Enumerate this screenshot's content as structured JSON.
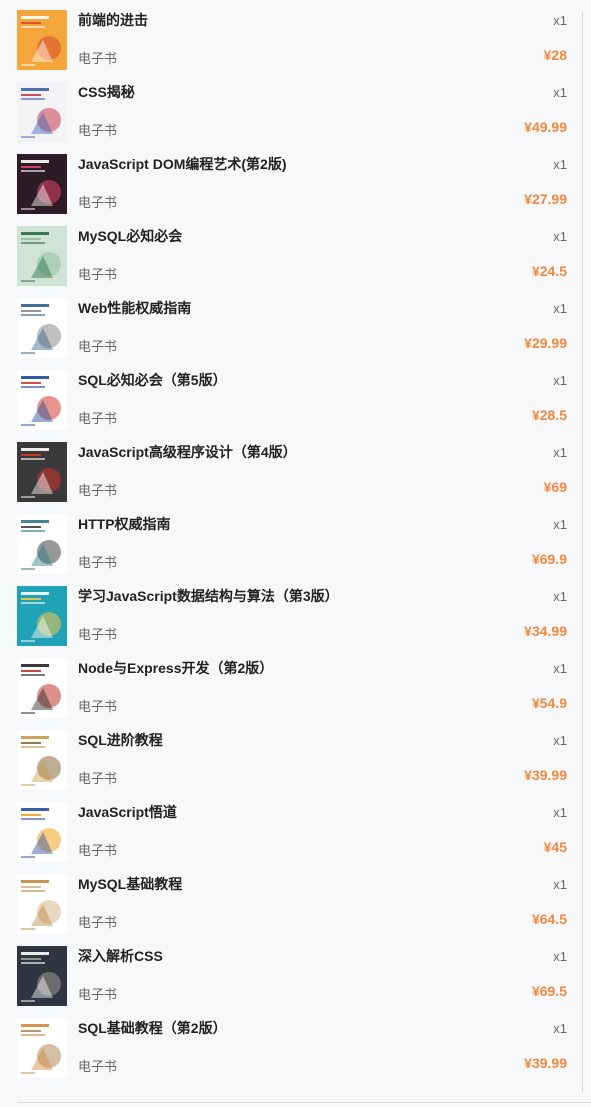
{
  "items": [
    {
      "title": "前端的进击",
      "qty": "x1",
      "type": "电子书",
      "price": "¥28",
      "cover": {
        "icon": "book-cover-front-end",
        "bg": "#f4a63a",
        "fg": "#ffffff",
        "accent": "#d84a2d"
      }
    },
    {
      "title": "CSS揭秘",
      "qty": "x1",
      "type": "电子书",
      "price": "¥49.99",
      "cover": {
        "icon": "book-cover-css-secrets",
        "bg": "#f3f3f6",
        "fg": "#3b63b0",
        "accent": "#cc3a4e"
      }
    },
    {
      "title": "JavaScript DOM编程艺术(第2版)",
      "qty": "x1",
      "type": "电子书",
      "price": "¥27.99",
      "cover": {
        "icon": "book-cover-dom-scripting",
        "bg": "#2b1c25",
        "fg": "#ffffff",
        "accent": "#e6416a"
      }
    },
    {
      "title": "MySQL必知必会",
      "qty": "x1",
      "type": "电子书",
      "price": "¥24.5",
      "cover": {
        "icon": "book-cover-mysql-crash-course",
        "bg": "#cfe4d6",
        "fg": "#2b6a47",
        "accent": "#8fbda1"
      }
    },
    {
      "title": "Web性能权威指南",
      "qty": "x1",
      "type": "电子书",
      "price": "¥29.99",
      "cover": {
        "icon": "book-cover-web-performance",
        "bg": "#ffffff",
        "fg": "#2f5f8a",
        "accent": "#8a8a8a"
      }
    },
    {
      "title": "SQL必知必会（第5版）",
      "qty": "x1",
      "type": "电子书",
      "price": "¥28.5",
      "cover": {
        "icon": "book-cover-sql-crash-course",
        "bg": "#ffffff",
        "fg": "#1d4b9c",
        "accent": "#d63b32"
      }
    },
    {
      "title": "JavaScript高级程序设计（第4版）",
      "qty": "x1",
      "type": "电子书",
      "price": "¥69",
      "cover": {
        "icon": "book-cover-professional-javascript",
        "bg": "#3a3a3a",
        "fg": "#ffffff",
        "accent": "#d1352c"
      }
    },
    {
      "title": "HTTP权威指南",
      "qty": "x1",
      "type": "电子书",
      "price": "¥69.9",
      "cover": {
        "icon": "book-cover-http-definitive-guide",
        "bg": "#ffffff",
        "fg": "#2a7a8c",
        "accent": "#444444"
      }
    },
    {
      "title": "学习JavaScript数据结构与算法（第3版）",
      "qty": "x1",
      "type": "电子书",
      "price": "¥34.99",
      "cover": {
        "icon": "book-cover-js-data-structures",
        "bg": "#21a3b7",
        "fg": "#ffffff",
        "accent": "#f7c548"
      }
    },
    {
      "title": "Node与Express开发（第2版）",
      "qty": "x1",
      "type": "电子书",
      "price": "¥54.9",
      "cover": {
        "icon": "book-cover-node-express",
        "bg": "#ffffff",
        "fg": "#222222",
        "accent": "#c0392b"
      }
    },
    {
      "title": "SQL进阶教程",
      "qty": "x1",
      "type": "电子书",
      "price": "¥39.99",
      "cover": {
        "icon": "book-cover-sql-advanced",
        "bg": "#ffffff",
        "fg": "#c89a4a",
        "accent": "#8a6a3a"
      }
    },
    {
      "title": "JavaScript悟道",
      "qty": "x1",
      "type": "电子书",
      "price": "¥45",
      "cover": {
        "icon": "book-cover-how-javascript-works",
        "bg": "#ffffff",
        "fg": "#2a4ea0",
        "accent": "#f1a21e"
      }
    },
    {
      "title": "MySQL基础教程",
      "qty": "x1",
      "type": "电子书",
      "price": "¥64.5",
      "cover": {
        "icon": "book-cover-mysql-basics",
        "bg": "#ffffff",
        "fg": "#c28a40",
        "accent": "#d5b78e"
      }
    },
    {
      "title": "深入解析CSS",
      "qty": "x1",
      "type": "电子书",
      "price": "¥69.5",
      "cover": {
        "icon": "book-cover-css-in-depth",
        "bg": "#2f3440",
        "fg": "#ffffff",
        "accent": "#a09a90"
      }
    },
    {
      "title": "SQL基础教程（第2版）",
      "qty": "x1",
      "type": "电子书",
      "price": "¥39.99",
      "cover": {
        "icon": "book-cover-sql-basics",
        "bg": "#ffffff",
        "fg": "#d08a3a",
        "accent": "#b38a5a"
      }
    }
  ]
}
